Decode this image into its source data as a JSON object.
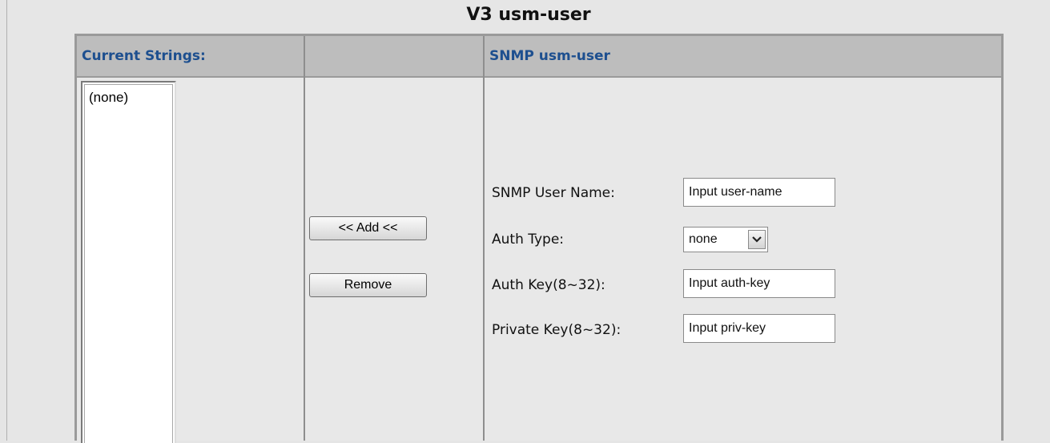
{
  "title": "V3 usm-user",
  "headers": {
    "current_strings": "Current Strings:",
    "middle": "",
    "snmp_usm_user": "SNMP usm-user"
  },
  "current_strings": [
    "(none)"
  ],
  "buttons": {
    "add": "<< Add <<",
    "remove": "Remove"
  },
  "form": {
    "user_name_label": "SNMP User Name:",
    "user_name_value": "Input user-name",
    "auth_type_label": "Auth Type:",
    "auth_type_value": "none",
    "auth_key_label": "Auth Key(8~32):",
    "auth_key_value": "Input auth-key",
    "priv_key_label": "Private Key(8~32):",
    "priv_key_value": "Input priv-key"
  },
  "icons": {
    "dropdown": "chevron-down-icon"
  }
}
